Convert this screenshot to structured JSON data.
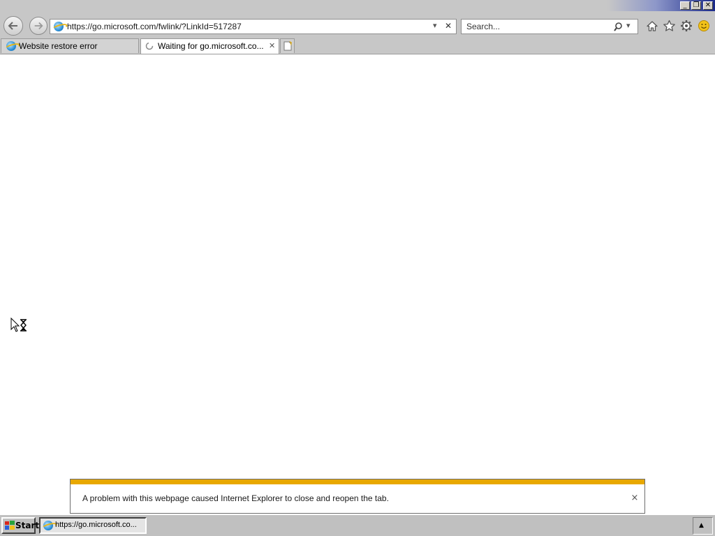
{
  "window": {
    "minimize_glyph": "_",
    "restore_glyph": "❐",
    "close_glyph": "✕"
  },
  "navigation": {
    "back_icon": "back-arrow-icon",
    "forward_icon": "forward-arrow-icon"
  },
  "address_bar": {
    "url": "https://go.microsoft.com/fwlink/?LinkId=517287",
    "dropdown_glyph": "▾",
    "stop_glyph": "✕"
  },
  "search": {
    "value": "Search...",
    "search_glyph": "⚲",
    "dropdown_glyph": "▾"
  },
  "toolbar_icons": [
    "home-icon",
    "favorites-star-icon",
    "tools-gear-icon",
    "feedback-smiley-icon"
  ],
  "tabs": [
    {
      "label": "Website restore error",
      "active": false
    },
    {
      "label": "Waiting for go.microsoft.co...",
      "active": true,
      "loading": true,
      "close_glyph": "✕"
    }
  ],
  "notification": {
    "message": "A problem with this webpage caused Internet Explorer to close and reopen the tab.",
    "close_glyph": "×",
    "accent_color": "#e8a800"
  },
  "taskbar": {
    "start_label": "Start",
    "task_label": "https://go.microsoft.co...",
    "tray_glyph": "▲"
  }
}
